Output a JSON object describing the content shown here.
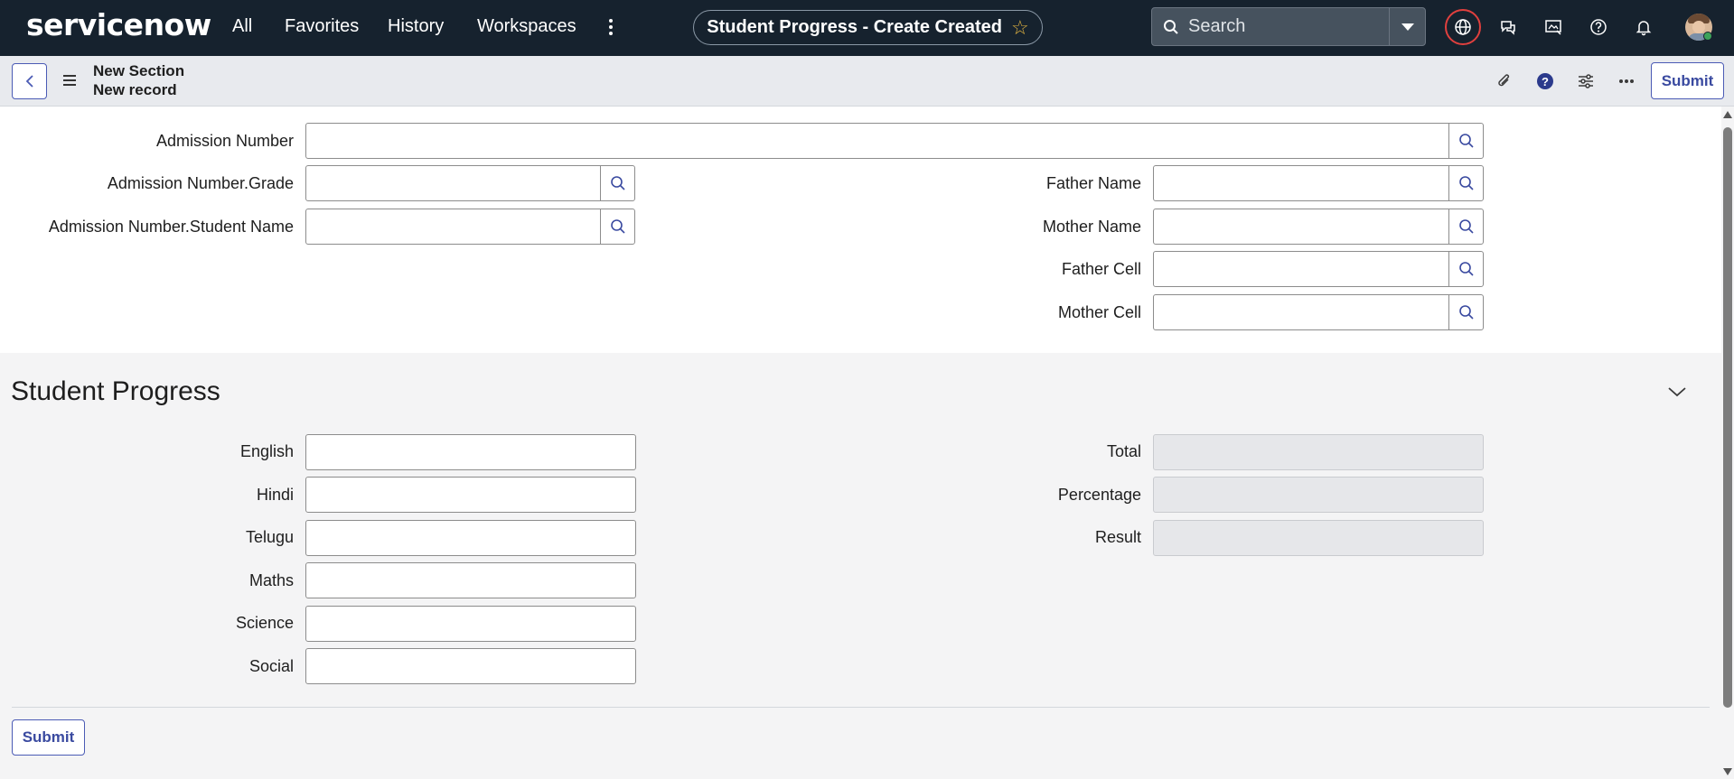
{
  "topnav": {
    "logo": "servicenow",
    "links": [
      "All",
      "Favorites",
      "History",
      "Workspaces"
    ],
    "page_title": "Student Progress - Create Created",
    "search_placeholder": "Search",
    "icons": [
      "globe-icon",
      "chat-icon",
      "presentation-icon",
      "help-icon",
      "bell-icon"
    ]
  },
  "subheader": {
    "line1": "New Section",
    "line2": "New record",
    "submit_label": "Submit"
  },
  "fields_top": {
    "admission_number": {
      "label": "Admission Number",
      "value": ""
    },
    "grade": {
      "label": "Admission Number.Grade",
      "value": ""
    },
    "student_name": {
      "label": "Admission Number.Student Name",
      "value": ""
    },
    "father_name": {
      "label": "Father Name",
      "value": ""
    },
    "mother_name": {
      "label": "Mother Name",
      "value": ""
    },
    "father_cell": {
      "label": "Father Cell",
      "value": ""
    },
    "mother_cell": {
      "label": "Mother Cell",
      "value": ""
    }
  },
  "section": {
    "title": "Student Progress",
    "subjects": {
      "english": {
        "label": "English",
        "value": ""
      },
      "hindi": {
        "label": "Hindi",
        "value": ""
      },
      "telugu": {
        "label": "Telugu",
        "value": ""
      },
      "maths": {
        "label": "Maths",
        "value": ""
      },
      "science": {
        "label": "Science",
        "value": ""
      },
      "social": {
        "label": "Social",
        "value": ""
      }
    },
    "computed": {
      "total": {
        "label": "Total",
        "value": ""
      },
      "percentage": {
        "label": "Percentage",
        "value": ""
      },
      "result": {
        "label": "Result",
        "value": ""
      }
    }
  },
  "footer": {
    "submit_label": "Submit"
  },
  "colors": {
    "nav_bg": "#16222e",
    "accent": "#4b5bb5",
    "alert_ring": "#e0403e"
  }
}
